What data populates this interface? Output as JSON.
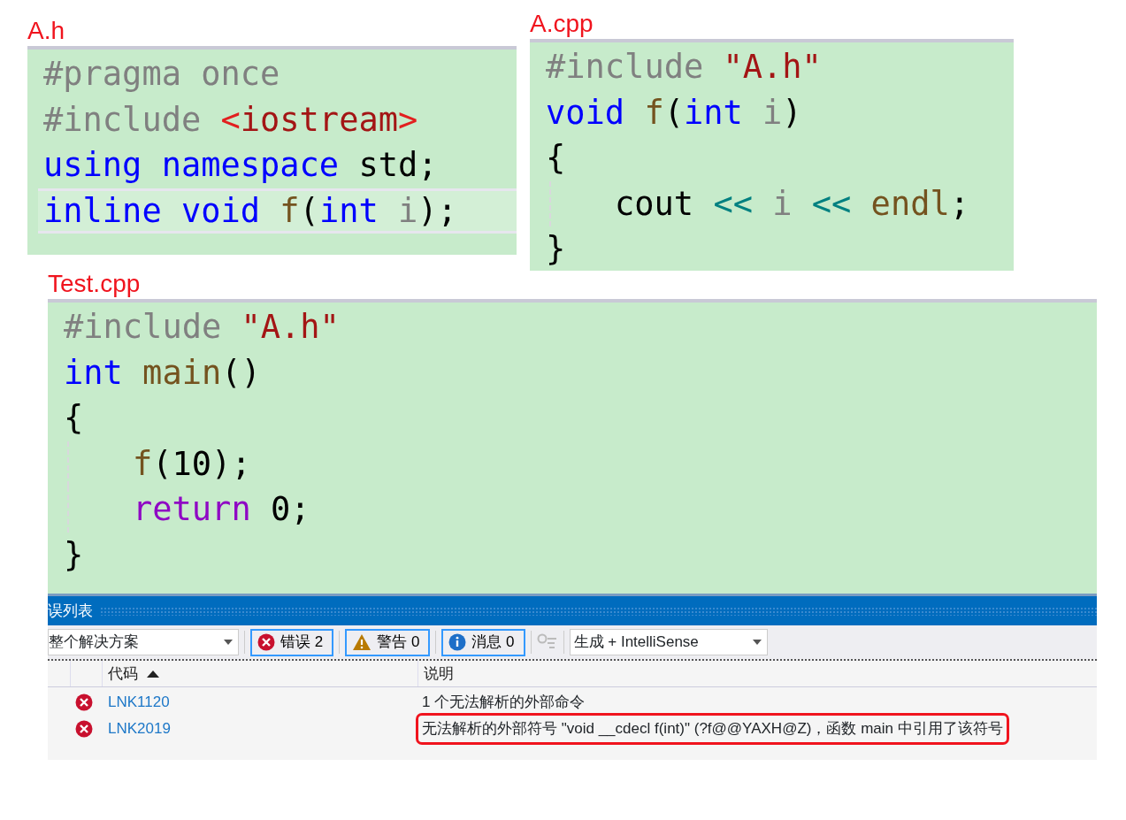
{
  "files": [
    {
      "label": "A.h",
      "lines": [
        {
          "indent": false,
          "current": false,
          "tokens": [
            {
              "text": "#pragma once",
              "kind": "directive"
            }
          ]
        },
        {
          "indent": false,
          "current": false,
          "tokens": [
            {
              "text": "#include ",
              "kind": "directive"
            },
            {
              "text": "<",
              "kind": "bracket"
            },
            {
              "text": "iostream",
              "kind": "string"
            },
            {
              "text": ">",
              "kind": "bracket"
            }
          ]
        },
        {
          "indent": false,
          "current": false,
          "tokens": [
            {
              "text": "using namespace ",
              "kind": "keyword"
            },
            {
              "text": "std;",
              "kind": "plain"
            }
          ]
        },
        {
          "indent": false,
          "current": true,
          "tokens": [
            {
              "text": "inline void ",
              "kind": "keyword"
            },
            {
              "text": "f",
              "kind": "func"
            },
            {
              "text": "(",
              "kind": "plain"
            },
            {
              "text": "int ",
              "kind": "keyword"
            },
            {
              "text": "i",
              "kind": "param"
            },
            {
              "text": ");",
              "kind": "plain"
            }
          ]
        }
      ]
    },
    {
      "label": "A.cpp",
      "lines": [
        {
          "indent": false,
          "current": false,
          "tokens": [
            {
              "text": "#include ",
              "kind": "directive"
            },
            {
              "text": "\"A.h\"",
              "kind": "string"
            }
          ]
        },
        {
          "indent": false,
          "current": false,
          "tokens": [
            {
              "text": "void ",
              "kind": "keyword"
            },
            {
              "text": "f",
              "kind": "func"
            },
            {
              "text": "(",
              "kind": "plain"
            },
            {
              "text": "int ",
              "kind": "keyword"
            },
            {
              "text": "i",
              "kind": "param"
            },
            {
              "text": ")",
              "kind": "plain"
            }
          ]
        },
        {
          "indent": false,
          "current": false,
          "tokens": [
            {
              "text": "{",
              "kind": "plain"
            }
          ]
        },
        {
          "indent": true,
          "current": false,
          "tokens": [
            {
              "text": "cout ",
              "kind": "plain"
            },
            {
              "text": "<< ",
              "kind": "operator"
            },
            {
              "text": "i ",
              "kind": "param"
            },
            {
              "text": "<< ",
              "kind": "operator"
            },
            {
              "text": "endl",
              "kind": "func"
            },
            {
              "text": ";",
              "kind": "plain"
            }
          ]
        },
        {
          "indent": false,
          "current": false,
          "tokens": [
            {
              "text": "}",
              "kind": "plain"
            }
          ]
        }
      ]
    },
    {
      "label": "Test.cpp",
      "lines": [
        {
          "indent": false,
          "current": false,
          "tokens": [
            {
              "text": "#include ",
              "kind": "directive"
            },
            {
              "text": "\"A.h\"",
              "kind": "string"
            }
          ]
        },
        {
          "indent": false,
          "current": false,
          "tokens": [
            {
              "text": "int ",
              "kind": "keyword"
            },
            {
              "text": "main",
              "kind": "func"
            },
            {
              "text": "()",
              "kind": "plain"
            }
          ]
        },
        {
          "indent": false,
          "current": false,
          "tokens": [
            {
              "text": "{",
              "kind": "plain"
            }
          ]
        },
        {
          "indent": true,
          "current": false,
          "tokens": [
            {
              "text": "f",
              "kind": "func"
            },
            {
              "text": "(10);",
              "kind": "plain"
            }
          ]
        },
        {
          "indent": true,
          "current": false,
          "tokens": [
            {
              "text": "return ",
              "kind": "control"
            },
            {
              "text": "0;",
              "kind": "plain"
            }
          ]
        },
        {
          "indent": false,
          "current": false,
          "tokens": [
            {
              "text": "}",
              "kind": "plain"
            }
          ]
        }
      ]
    }
  ],
  "error_list": {
    "title": "误列表",
    "scope": "整个解决方案",
    "filters": [
      {
        "kind": "error",
        "label": "错误 2",
        "selected": true
      },
      {
        "kind": "warning",
        "label": "警告 0",
        "selected": true
      },
      {
        "kind": "info",
        "label": "消息 0",
        "selected": true
      }
    ],
    "source": "生成 + IntelliSense",
    "columns": [
      "代码",
      "说明"
    ],
    "rows": [
      {
        "code": "LNK1120",
        "description": "1 个无法解析的外部命令",
        "annotated": false
      },
      {
        "code": "LNK2019",
        "description": "无法解析的外部符号 \"void __cdecl f(int)\" (?f@@YAXH@Z)，函数 main 中引用了该符号",
        "annotated": true
      }
    ]
  }
}
